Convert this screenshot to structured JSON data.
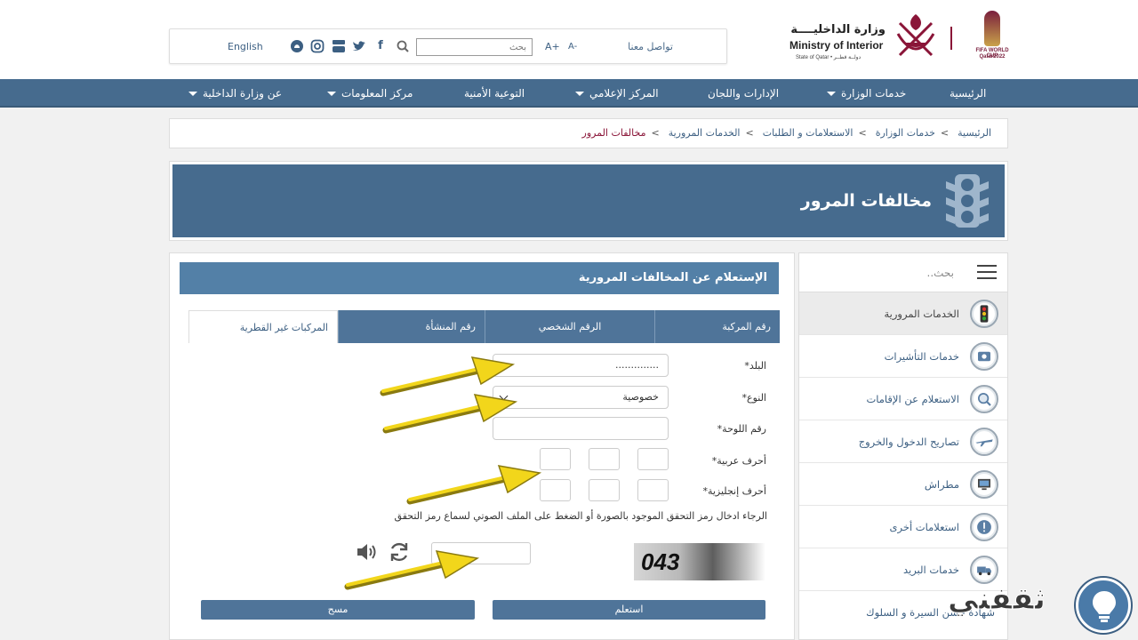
{
  "header": {
    "logo_ar": "وزارة الداخليــــة",
    "logo_en": "Ministry of Interior",
    "logo_sub": "State of Qatar • دولــة قطــر",
    "fifa_line1": "FIFA WORLD CUP",
    "fifa_line2": "Qatar2022"
  },
  "topbar": {
    "contact": "تواصل معنا",
    "font_decrease": "A-",
    "font_increase": "A+",
    "search_placeholder": "بحث",
    "language": "English"
  },
  "nav": {
    "items": [
      {
        "label": "الرئيسية"
      },
      {
        "label": "خدمات الوزارة"
      },
      {
        "label": "الإدارات واللجان"
      },
      {
        "label": "المركز الإعلامي"
      },
      {
        "label": "التوعية الأمنية"
      },
      {
        "label": "مركز المعلومات"
      },
      {
        "label": "عن وزارة الداخلية"
      }
    ]
  },
  "breadcrumb": {
    "items": [
      "الرئيسية",
      "خدمات الوزارة",
      "الاستعلامات و الطلبات",
      "الخدمات المرورية",
      "مخالفات المرور"
    ],
    "separator": ">"
  },
  "banner": {
    "title": "مخالفات المرور"
  },
  "sidebar": {
    "search_placeholder": "بحث..",
    "items": [
      {
        "label": "الخدمات المرورية"
      },
      {
        "label": "خدمات التأشيرات"
      },
      {
        "label": "الاستعلام عن الإقامات"
      },
      {
        "label": "تصاريح الدخول والخروج"
      },
      {
        "label": "مطراش"
      },
      {
        "label": "استعلامات أخرى"
      },
      {
        "label": "خدمات البريد"
      },
      {
        "label": "شهادة حسن السيرة و السلوك"
      }
    ]
  },
  "form": {
    "title": "الإستعلام عن المخالفات المرورية",
    "tabs": [
      {
        "label": "رقم المركبة"
      },
      {
        "label": "الرقم الشخصي"
      },
      {
        "label": "رقم المنشأة"
      },
      {
        "label": "المركبات غير القطرية"
      }
    ],
    "country_label": "البلد*",
    "country_value": "..............",
    "type_label": "النوع*",
    "type_value": "خصوصية",
    "plate_label": "رقم اللوحة*",
    "arabic_letters_label": "أحرف عربية*",
    "english_letters_label": "أحرف إنجليزية*",
    "captcha_hint": "الرجاء ادخال رمز التحقق الموجود بالصورة أو الضغط على الملف الصوتي لسماع رمز التحقق",
    "captcha_text": "043",
    "submit_label": "استعلم",
    "clear_label": "مسح"
  },
  "watermark": {
    "text": "ثقفني"
  },
  "colors": {
    "primary": "#466b8e",
    "tab_active": "#4f7499",
    "header_blue": "#5380a7",
    "maroon": "#8a1538",
    "arrow_yellow": "#f2d61b"
  }
}
